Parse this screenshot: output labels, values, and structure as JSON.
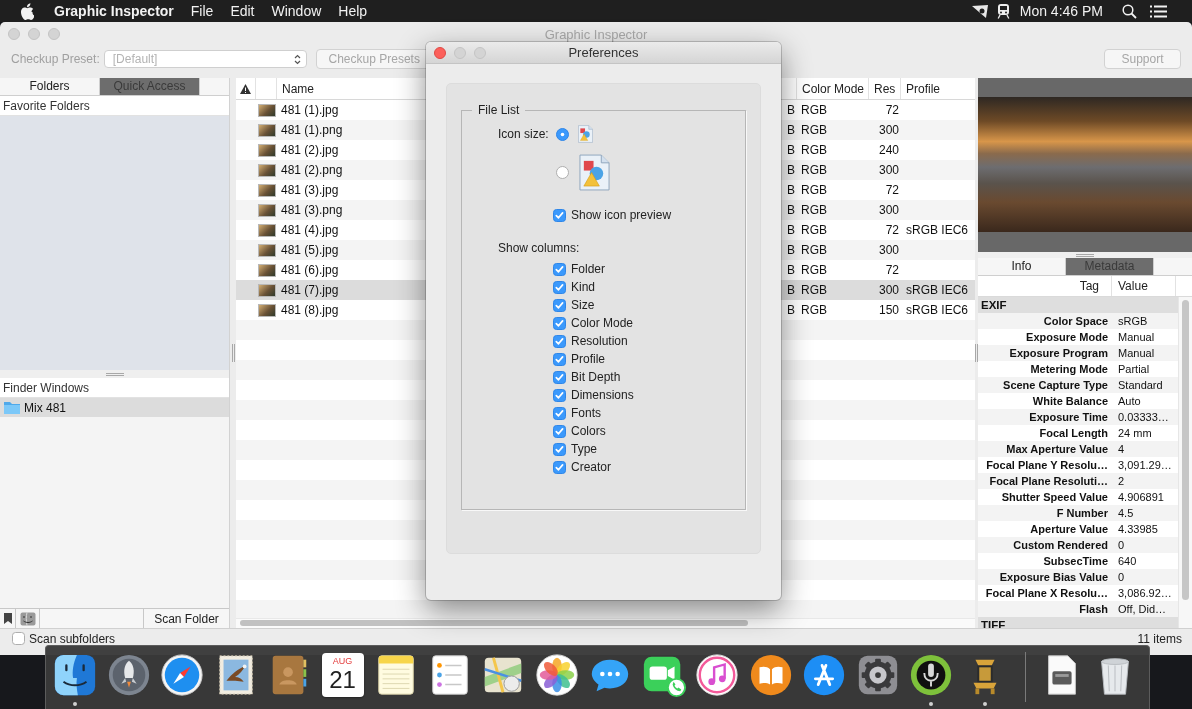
{
  "menu_bar": {
    "app_name": "Graphic Inspector",
    "menus": [
      "File",
      "Edit",
      "Window",
      "Help"
    ],
    "clock": "Mon 4:46 PM"
  },
  "window": {
    "title": "Graphic Inspector",
    "active": false
  },
  "toolbar": {
    "preset_label": "Checkup Preset:",
    "preset": {
      "value": "[Default]",
      "disabled": true
    },
    "presets_button": {
      "label": "Checkup Presets",
      "disabled": true
    },
    "support_button": {
      "label": "Support",
      "disabled": true
    }
  },
  "sidebar": {
    "tabs": [
      {
        "label": "Folders",
        "selected": false
      },
      {
        "label": "Quick Access",
        "selected": true
      }
    ],
    "favorites_title": "Favorite Folders",
    "finder_title": "Finder Windows",
    "finder_windows": [
      {
        "label": "Mix 481",
        "selected": true
      }
    ],
    "scan_button": "Scan Folder"
  },
  "file_list": {
    "columns": [
      "Name",
      "Color Mode",
      "Res",
      "Profile"
    ],
    "rows": [
      {
        "name": "481 (1).jpg",
        "column_3": "B",
        "color_mode": "RGB",
        "res": "72",
        "selected": false
      },
      {
        "name": "481 (1).png",
        "column_3": "B",
        "color_mode": "RGB",
        "res": "300",
        "selected": false
      },
      {
        "name": "481 (2).jpg",
        "column_3": "B",
        "color_mode": "RGB",
        "res": "240",
        "selected": false
      },
      {
        "name": "481 (2).png",
        "column_3": "B",
        "color_mode": "RGB",
        "res": "300",
        "selected": false
      },
      {
        "name": "481 (3).jpg",
        "column_3": "B",
        "color_mode": "RGB",
        "res": "72",
        "selected": false
      },
      {
        "name": "481 (3).png",
        "column_3": "B",
        "color_mode": "RGB",
        "res": "300",
        "selected": false
      },
      {
        "name": "481 (4).jpg",
        "column_3": "B",
        "color_mode": "RGB",
        "res": "72",
        "profile": "sRGB IEC6",
        "selected": false
      },
      {
        "name": "481 (5).jpg",
        "column_3": "B",
        "color_mode": "RGB",
        "res": "300",
        "selected": false
      },
      {
        "name": "481 (6).jpg",
        "column_3": "B",
        "color_mode": "RGB",
        "res": "72",
        "selected": false
      },
      {
        "name": "481 (7).jpg",
        "column_3": "B",
        "color_mode": "RGB",
        "res": "300",
        "profile": "sRGB IEC6",
        "selected": true
      },
      {
        "name": "481 (8).jpg",
        "column_3": "B",
        "color_mode": "RGB",
        "res": "150",
        "profile": "sRGB IEC6",
        "selected": false
      }
    ]
  },
  "inspector": {
    "tabs": [
      {
        "label": "Info",
        "selected": false
      },
      {
        "label": "Metadata",
        "selected": true
      }
    ],
    "columns": [
      "Tag",
      "Value"
    ],
    "groups": [
      {
        "title": "EXIF",
        "rows": [
          {
            "tag": "Color Space",
            "value": "sRGB"
          },
          {
            "tag": "Exposure Mode",
            "value": "Manual"
          },
          {
            "tag": "Exposure Program",
            "value": "Manual"
          },
          {
            "tag": "Metering Mode",
            "value": "Partial"
          },
          {
            "tag": "Scene Capture Type",
            "value": "Standard"
          },
          {
            "tag": "White Balance",
            "value": "Auto"
          },
          {
            "tag": "Exposure Time",
            "value": "0.03333…"
          },
          {
            "tag": "Focal Length",
            "value": "24 mm"
          },
          {
            "tag": "Max Aperture Value",
            "value": "4"
          },
          {
            "tag": "Focal Plane Y Resolu…",
            "value": "3,091.29…"
          },
          {
            "tag": "Focal Plane Resoluti…",
            "value": "2"
          },
          {
            "tag": "Shutter Speed Value",
            "value": "4.906891"
          },
          {
            "tag": "F Number",
            "value": "4.5"
          },
          {
            "tag": "Aperture Value",
            "value": "4.33985"
          },
          {
            "tag": "Custom Rendered",
            "value": "0"
          },
          {
            "tag": "SubsecTime",
            "value": "640"
          },
          {
            "tag": "Exposure Bias Value",
            "value": "0"
          },
          {
            "tag": "Focal Plane X Resolu…",
            "value": "3,086.92…"
          },
          {
            "tag": "Flash",
            "value": "Off, Did…"
          }
        ]
      },
      {
        "title": "TIFF"
      }
    ]
  },
  "status_bar": {
    "scan_subfolders": {
      "label": "Scan subfolders",
      "checked": false
    },
    "item_count": "11 items"
  },
  "preferences": {
    "title": "Preferences",
    "group_title": "File List",
    "icon_size_label": "Icon size:",
    "icon_sizes": [
      {
        "kind": "small",
        "selected": true
      },
      {
        "kind": "large",
        "selected": false
      }
    ],
    "show_icon_preview": {
      "label": "Show icon preview",
      "checked": true
    },
    "columns_label": "Show columns:",
    "columns": [
      {
        "label": "Folder",
        "checked": true
      },
      {
        "label": "Kind",
        "checked": true
      },
      {
        "label": "Size",
        "checked": true
      },
      {
        "label": "Color Mode",
        "checked": true
      },
      {
        "label": "Resolution",
        "checked": true
      },
      {
        "label": "Profile",
        "checked": true
      },
      {
        "label": "Bit Depth",
        "checked": true
      },
      {
        "label": "Dimensions",
        "checked": true
      },
      {
        "label": "Fonts",
        "checked": true
      },
      {
        "label": "Colors",
        "checked": true
      },
      {
        "label": "Type",
        "checked": true
      },
      {
        "label": "Creator",
        "checked": true
      }
    ]
  },
  "dock": {
    "apps": [
      {
        "kind": "finder",
        "running": true
      },
      {
        "kind": "launchpad",
        "running": false
      },
      {
        "kind": "safari",
        "running": false
      },
      {
        "kind": "stamp",
        "running": false
      },
      {
        "kind": "contacts",
        "running": false
      },
      {
        "kind": "calendar",
        "month": "AUG",
        "day": "21",
        "running": false
      },
      {
        "kind": "notes",
        "running": false
      },
      {
        "kind": "reminders",
        "running": false
      },
      {
        "kind": "maps",
        "running": false
      },
      {
        "kind": "photos",
        "running": false
      },
      {
        "kind": "messages",
        "running": false
      },
      {
        "kind": "facetime",
        "running": false
      },
      {
        "kind": "music",
        "running": false
      },
      {
        "kind": "books",
        "running": false
      },
      {
        "kind": "appstore",
        "running": false
      },
      {
        "kind": "settings",
        "running": false
      },
      {
        "kind": "microphone",
        "running": true
      },
      {
        "kind": "lamp",
        "running": true
      }
    ],
    "stacks": [
      {
        "kind": "document"
      },
      {
        "kind": "trash"
      }
    ]
  }
}
